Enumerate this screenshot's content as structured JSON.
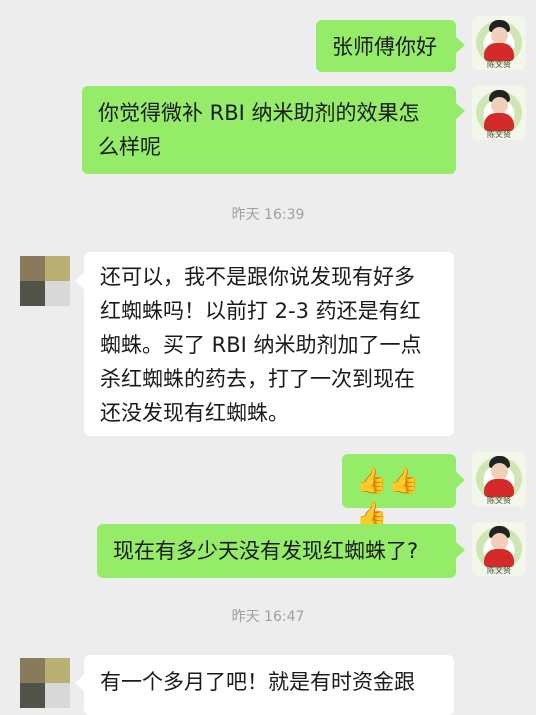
{
  "chat": {
    "messages": [
      {
        "sender": "me",
        "text": "张师傅你好"
      },
      {
        "sender": "me",
        "lines": [
          "你觉得微补 RBI 纳米助剂的效果怎",
          "么样呢"
        ]
      },
      {
        "sender": "them",
        "lines": [
          "还可以，我不是跟你说发现有好多",
          "红蜘蛛吗！以前打 2-3 药还是有红",
          "蜘蛛。买了 RBI 纳米助剂加了一点",
          "杀红蜘蛛的药去，打了一次到现在",
          "还没发现有红蜘蛛。"
        ]
      },
      {
        "sender": "me",
        "text": "👍👍👍"
      },
      {
        "sender": "me",
        "text": "现在有多少天没有发现红蜘蛛了?"
      },
      {
        "sender": "them",
        "text": "有一个多月了吧！就是有时资金跟"
      }
    ],
    "timestamps": [
      "昨天 16:39",
      "昨天 16:47"
    ]
  },
  "avatars": {
    "me": {
      "caption": "陈文贤",
      "colors": {
        "shirt": "#d42a2a",
        "hair": "#222222",
        "ring": "#cfe6b4"
      }
    },
    "them": {
      "colors": [
        "#8a7a5c",
        "#b9b074",
        "#4f5348",
        "#d8d8d8"
      ]
    }
  },
  "colors": {
    "background": "#ededed",
    "sent_bubble": "#95ec69",
    "received_bubble": "#ffffff",
    "timestamp": "#a0a0a0"
  }
}
